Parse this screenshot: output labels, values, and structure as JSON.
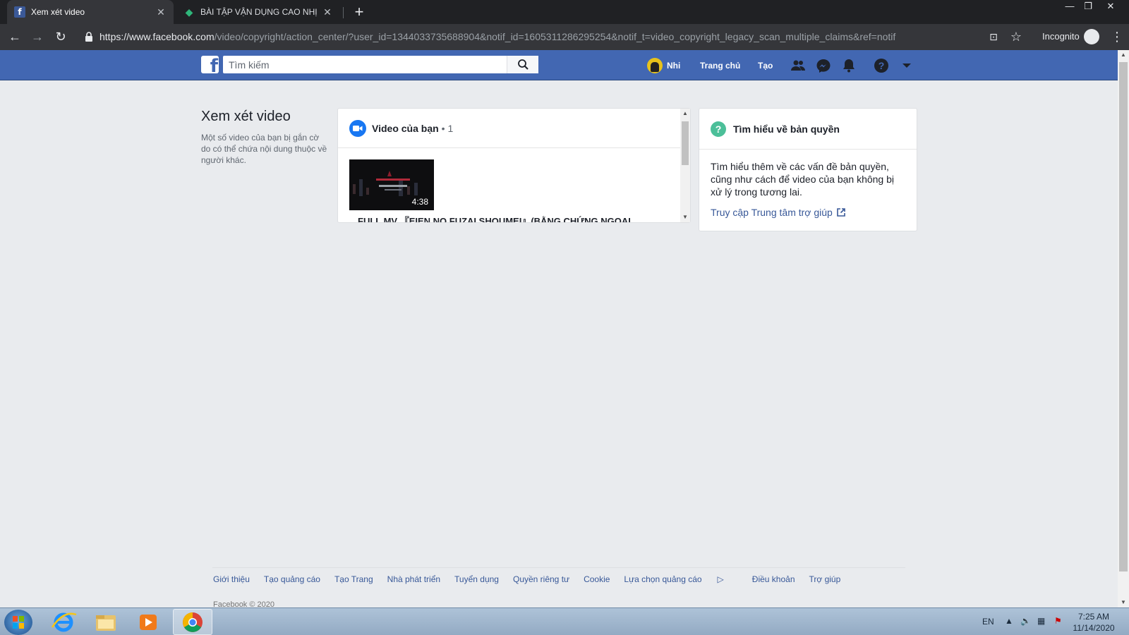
{
  "browser": {
    "tabs": [
      {
        "title": "Xem xét video"
      },
      {
        "title": "BÀI TẬP VẬN DỤNG CAO NHỊ TH"
      }
    ],
    "url_host": "https://www.facebook.com",
    "url_path": "/video/copyright/action_center/?user_id=1344033735688904&notif_id=1605311286295254&notif_t=video_copyright_legacy_scan_multiple_claims&ref=notif",
    "incognito_label": "Incognito"
  },
  "fb_header": {
    "search_placeholder": "Tìm kiếm",
    "user_name": "Nhi",
    "home_label": "Trang chủ",
    "create_label": "Tạo"
  },
  "page": {
    "title": "Xem xét video",
    "description": "Một số video của bạn bị gắn cờ do có thể chứa nội dung thuộc về người khác."
  },
  "video_panel": {
    "header": "Video của bạn",
    "count": "• 1",
    "videos": [
      {
        "duration": "4:38",
        "title": "FULL MV 『EIEN NO FUZAI SHOUMEI』(BẰNG CHỨNG NGOẠI"
      }
    ]
  },
  "copyright_panel": {
    "title": "Tìm hiểu về bản quyền",
    "body": "Tìm hiểu thêm về các vấn đề bản quyền, cũng như cách để video của bạn không bị xử lý trong tương lai.",
    "link": "Truy cập Trung tâm trợ giúp"
  },
  "footer": {
    "links": [
      "Giới thiệu",
      "Tạo quảng cáo",
      "Tạo Trang",
      "Nhà phát triển",
      "Tuyển dụng",
      "Quyền riêng tư",
      "Cookie",
      "Lựa chọn quảng cáo",
      "Điều khoản",
      "Trợ giúp"
    ],
    "copyright": "Facebook © 2020"
  },
  "taskbar": {
    "language": "EN",
    "time": "7:25 AM",
    "date": "11/14/2020"
  },
  "colors": {
    "fb_blue": "#4267b2",
    "link_blue": "#385898",
    "page_bg": "#e9ebee",
    "chrome_dark": "#202124"
  }
}
